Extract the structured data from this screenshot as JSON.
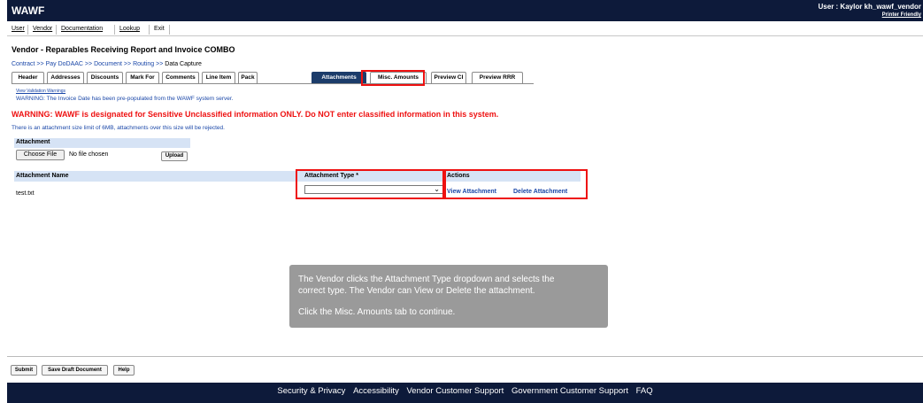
{
  "header": {
    "logo": "WAWF",
    "user": "User : Kaylor kh_wawf_vendor",
    "printer": "Printer Friendly"
  },
  "menu": [
    "User",
    "Vendor",
    "Documentation",
    "Lookup",
    "Exit"
  ],
  "page": {
    "title": "Vendor - Reparables Receiving Report and Invoice COMBO",
    "breadcrumb": [
      "Contract",
      "Pay DoDAAC",
      "Document",
      "Routing"
    ],
    "breadcrumb_sep": ">>",
    "breadcrumb_current": "Data Capture"
  },
  "tabs": [
    {
      "label": "Header"
    },
    {
      "label": "Addresses"
    },
    {
      "label": "Discounts"
    },
    {
      "label": "Mark For"
    },
    {
      "label": "Comments"
    },
    {
      "label": "Line Item"
    },
    {
      "label": "Pack"
    },
    {
      "label": "Attachments",
      "active": true
    },
    {
      "label": "Misc. Amounts"
    },
    {
      "label": "Preview CI"
    },
    {
      "label": "Preview RRR"
    }
  ],
  "messages": {
    "validation_link": "View Validation Warnings",
    "invoice_date_warning": "WARNING: The Invoice Date has been pre-populated from the WAWF system server.",
    "classified_warning": "WARNING: WAWF is designated for Sensitive Unclassified information ONLY. Do NOT enter classified information in this system.",
    "size_limit": "There is an attachment size limit of 6MB, attachments over this size will be rejected."
  },
  "attachment": {
    "section_label": "Attachment",
    "choose_file": "Choose File",
    "no_file": "No file chosen",
    "upload": "Upload"
  },
  "table": {
    "col_name": "Attachment Name",
    "col_type": "Attachment Type *",
    "col_actions": "Actions",
    "rows": [
      {
        "name": "test.txt",
        "type": "",
        "view": "View Attachment",
        "delete": "Delete Attachment"
      }
    ]
  },
  "tooltip": {
    "line1": "The Vendor clicks the Attachment Type dropdown and selects the",
    "line2": "correct type. The Vendor can View or Delete the attachment.",
    "line3": "Click the Misc. Amounts tab to continue."
  },
  "buttons": {
    "submit": "Submit",
    "save_draft": "Save Draft Document",
    "help": "Help"
  },
  "footer": [
    "Security & Privacy",
    "Accessibility",
    "Vendor Customer Support",
    "Government Customer Support",
    "FAQ"
  ],
  "colors": {
    "header_bg": "#0d1a3a",
    "link": "#1a47a8",
    "warning": "#e11111",
    "active_tab": "#1c3c6a",
    "highlight_box": "#e11111"
  }
}
